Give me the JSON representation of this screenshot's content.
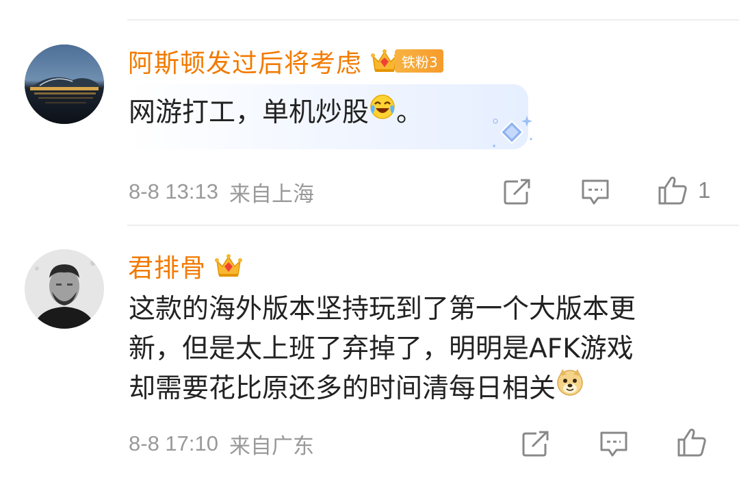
{
  "comments": [
    {
      "username": "阿斯顿发过后将考虑",
      "fan_badge": "铁粉3",
      "text": "网游打工，单机炒股",
      "text_suffix": "。",
      "emoji": "laugh-cry-emoji",
      "date": "8-8 13:13",
      "location": "来自上海",
      "likes": "1"
    },
    {
      "username": "君排骨",
      "text_lines": [
        "这款的海外版本坚持玩到了第一个大版本更",
        "新，但是太上班了弃掉了，明明是AFK游戏",
        "却需要花比原还多的时间清每日相关"
      ],
      "emoji": "doge-emoji",
      "date": "8-8 17:10",
      "location": "来自广东"
    }
  ],
  "icons": {
    "share": "share-icon",
    "comment": "comment-icon",
    "like": "thumbs-up-icon",
    "crown": "vip-crown-icon"
  },
  "colors": {
    "username": "#f27a00",
    "meta": "#999999",
    "text": "#222222",
    "badge": "#f6a534"
  }
}
